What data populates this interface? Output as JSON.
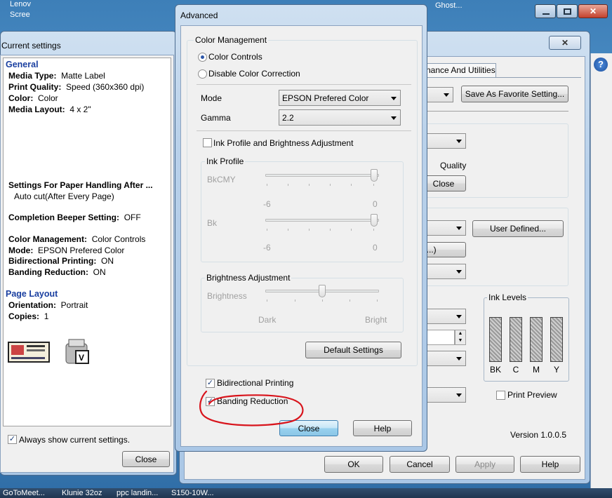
{
  "desktop": {
    "top_left_text_1": "Lenov",
    "top_left_text_2": "Scree",
    "top_right_text": "Ghost..."
  },
  "taskbar": {
    "items": [
      "GoToMeet...",
      "Klunie 32oz",
      "ppc landin...",
      "S150-10W..."
    ]
  },
  "current_settings": {
    "title": "Current settings",
    "general_header": "General",
    "rows": [
      {
        "label": "Media Type:",
        "value": "Matte Label"
      },
      {
        "label": "Print Quality:",
        "value": "Speed (360x360 dpi)"
      },
      {
        "label": "Color:",
        "value": "Color"
      },
      {
        "label": "Media Layout:",
        "value": "4 x 2\""
      }
    ],
    "paper_handling_label": "Settings For Paper Handling After ...",
    "paper_handling_value": "Auto cut(After Every Page)",
    "beeper_label": "Completion Beeper Setting:",
    "beeper_value": "OFF",
    "color_rows": [
      {
        "label": "Color Management:",
        "value": "Color Controls"
      },
      {
        "label": "Mode:",
        "value": "EPSON Prefered Color"
      },
      {
        "label": "Bidirectional Printing:",
        "value": "ON"
      },
      {
        "label": "Banding Reduction:",
        "value": "ON"
      }
    ],
    "page_layout_header": "Page Layout",
    "layout_rows": [
      {
        "label": "Orientation:",
        "value": "Portrait"
      },
      {
        "label": "Copies:",
        "value": "1"
      }
    ],
    "always_show_label": "Always show current settings.",
    "always_show_checked": true,
    "close_label": "Close"
  },
  "printer_dialog": {
    "tab_label": "nance And Utilities",
    "save_favorite_label": "Save As Favorite Setting...",
    "quality_label": "Quality",
    "close_partial_label": "Close",
    "user_defined_label": "User Defined...",
    "op_partial_label": "p...)",
    "ink_levels_title": "Ink Levels",
    "ink_labels": [
      "BK",
      "C",
      "M",
      "Y"
    ],
    "print_preview_label": "Print Preview",
    "version_label": "Version 1.0.0.5",
    "ok_label": "OK",
    "cancel_label": "Cancel",
    "apply_label": "Apply",
    "help_label": "Help",
    "help_icon_glyph": "?"
  },
  "advanced": {
    "title": "Advanced",
    "color_management_title": "Color Management",
    "radio_color_controls": "Color Controls",
    "radio_disable": "Disable Color Correction",
    "mode_label": "Mode",
    "mode_value": "EPSON Prefered Color",
    "gamma_label": "Gamma",
    "gamma_value": "2.2",
    "ink_profile_check_label": "Ink Profile and Brightness Adjustment",
    "ink_profile_title": "Ink Profile",
    "bkcmy_label": "BkCMY",
    "bk_label": "Bk",
    "slider_min": "-6",
    "slider_max": "0",
    "bkcmy_value": 0,
    "bk_value": 0,
    "brightness_group_title": "Brightness Adjustment",
    "brightness_label": "Brightness",
    "dark_label": "Dark",
    "bright_label": "Bright",
    "default_settings_label": "Default Settings",
    "bidirectional_label": "Bidirectional Printing",
    "bidirectional_checked": true,
    "banding_label": "Banding Reduction",
    "banding_checked": true,
    "close_label": "Close",
    "help_label": "Help",
    "annotation_color": "#d8141c"
  }
}
